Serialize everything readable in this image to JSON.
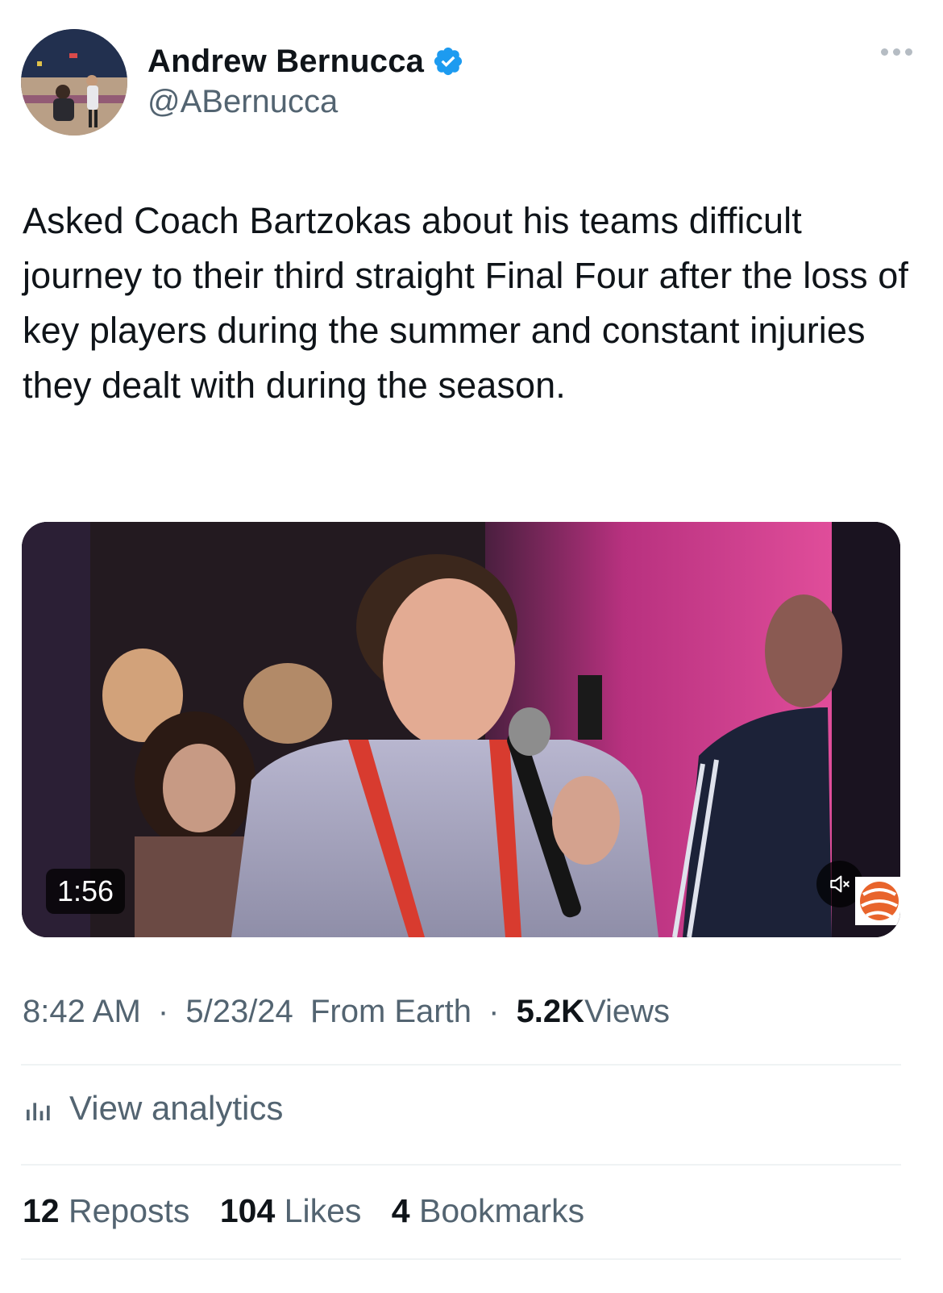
{
  "author": {
    "display_name": "Andrew Bernucca",
    "handle": "@ABernucca",
    "verified_icon": "verified-badge-icon",
    "verified_color": "#1d9bf0"
  },
  "tweet": {
    "text": "Asked Coach Bartzokas about his teams difficult journey to their third straight Final Four after the loss of key players during the summer and constant injuries they dealt with during the season."
  },
  "media": {
    "duration": "1:56",
    "mute_icon": "speaker-muted-icon"
  },
  "meta": {
    "time": "8:42 AM",
    "date": "5/23/24",
    "source": "From Earth",
    "views_count": "5.2K",
    "views_label": "Views",
    "separator": "·"
  },
  "analytics": {
    "label": "View analytics",
    "icon": "analytics-bars-icon"
  },
  "stats": {
    "reposts_count": "12",
    "reposts_label": "Reposts",
    "likes_count": "104",
    "likes_label": "Likes",
    "bookmarks_count": "4",
    "bookmarks_label": "Bookmarks"
  }
}
